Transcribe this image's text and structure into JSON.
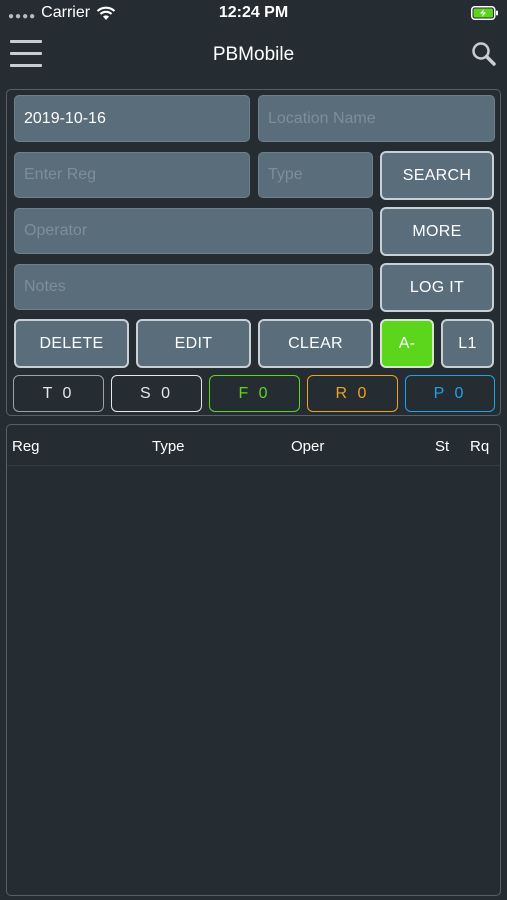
{
  "status_bar": {
    "carrier": "Carrier",
    "time": "12:24 PM"
  },
  "nav": {
    "title": "PBMobile"
  },
  "form": {
    "date_value": "2019-10-16",
    "location_placeholder": "Location Name",
    "reg_placeholder": "Enter Reg",
    "type_placeholder": "Type",
    "operator_placeholder": "Operator",
    "notes_placeholder": "Notes"
  },
  "buttons": {
    "search": "SEARCH",
    "more": "MORE",
    "log_it": "LOG IT",
    "delete": "DELETE",
    "edit": "EDIT",
    "clear": "CLEAR",
    "a_minus": "A-",
    "l1": "L1"
  },
  "counters": [
    {
      "label": "T 0",
      "color": "#9aa3aa"
    },
    {
      "label": "S 0",
      "color": "#e6e6e6"
    },
    {
      "label": "F 0",
      "color": "#5cd61c"
    },
    {
      "label": "R 0",
      "color": "#f0a023"
    },
    {
      "label": "P 0",
      "color": "#1fa3e6"
    }
  ],
  "table": {
    "columns": [
      "Reg",
      "Type",
      "Oper",
      "St",
      "Rq"
    ]
  },
  "colors": {
    "background": "#252d33",
    "field": "#5a6d7a",
    "accent_green": "#5cd61c"
  },
  "icons": {
    "menu": "hamburger-menu-icon",
    "search": "search-icon",
    "wifi": "wifi-icon",
    "battery": "battery-charging-icon"
  }
}
